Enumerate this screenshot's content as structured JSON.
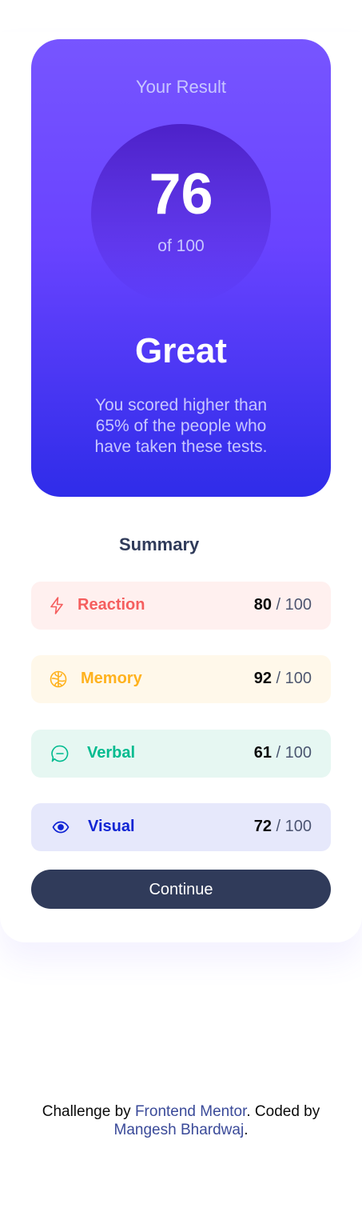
{
  "result": {
    "title": "Your Result",
    "score": "76",
    "score_of": "of 100",
    "rating": "Great",
    "description": "You scored higher than 65% of the people who have taken these tests."
  },
  "summary": {
    "title": "Summary",
    "items": [
      {
        "label": "Reaction",
        "score": "80",
        "out_of": "/ 100",
        "icon": "lightning-icon",
        "color": "#f55e5e"
      },
      {
        "label": "Memory",
        "score": "92",
        "out_of": "/ 100",
        "icon": "brain-icon",
        "color": "#ffb21e"
      },
      {
        "label": "Verbal",
        "score": "61",
        "out_of": "/ 100",
        "icon": "chat-bubble-icon",
        "color": "#00bb8f"
      },
      {
        "label": "Visual",
        "score": "72",
        "out_of": "/ 100",
        "icon": "eye-icon",
        "color": "#1125d4"
      }
    ],
    "continue_label": "Continue"
  },
  "footer": {
    "prefix": "Challenge by ",
    "challenge_link": "Frontend Mentor",
    "middle": ". Coded by ",
    "author_link": "Mangesh Bhardwaj",
    "suffix": "."
  },
  "colors": {
    "accent_gradient_top": "#7755ff",
    "accent_gradient_bottom": "#2f2ce9",
    "dark_navy": "#303b5a"
  }
}
